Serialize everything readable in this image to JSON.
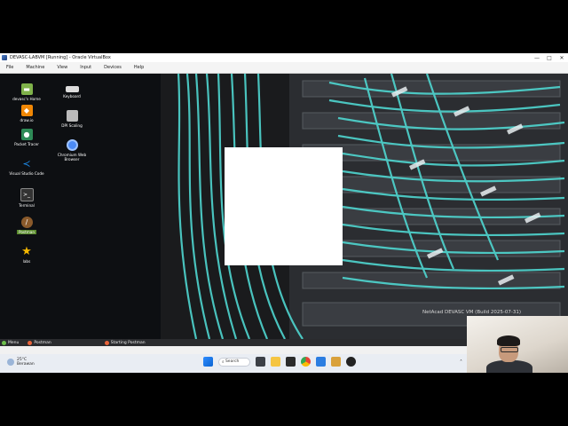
{
  "window": {
    "title": "DEVASC-LABVM [Running] - Oracle VirtualBox",
    "controls": [
      "—",
      "□",
      "✕"
    ]
  },
  "menu": [
    "File",
    "Machine",
    "View",
    "Input",
    "Devices",
    "Help"
  ],
  "desktop_icons": [
    {
      "label": "devasc's Home",
      "icon": "folder-icon",
      "color": "#7fb24a"
    },
    {
      "label": "draw.io",
      "icon": "drawio-icon",
      "color": "#f08705"
    },
    {
      "label": "Packet Tracer",
      "icon": "packet-tracer-icon",
      "color": "#2e8b57"
    },
    {
      "label": "Visual Studio Code",
      "icon": "vscode-icon",
      "color": "#1e88e5"
    },
    {
      "label": "Terminal",
      "icon": "terminal-icon",
      "color": "#333333"
    },
    {
      "label": "Postman",
      "icon": "postman-icon",
      "color": "#8a5a2b"
    },
    {
      "label": "labs",
      "icon": "star-icon",
      "color": "#f5b800"
    },
    {
      "label": "Keyboard",
      "icon": "keyboard-icon",
      "color": "#dddddd"
    },
    {
      "label": "DPI Scaling",
      "icon": "dpi-scaling-icon",
      "color": "#bbbbbb"
    },
    {
      "label": "Chromium Web Browser",
      "icon": "chromium-icon",
      "color": "#4c8bf5"
    }
  ],
  "wallpaper_watermark": "NetAcad DEVASC VM (Build 2025-07-31)",
  "guest_taskbar": [
    {
      "label": "Menu",
      "color": "#6dbf4b"
    },
    {
      "label": "Postman",
      "color": "#e8633a"
    },
    {
      "label": "Starting Postman",
      "color": "#e8633a"
    }
  ],
  "host_taskbar": {
    "weather_temp": "25°C",
    "weather_desc": "Berawan",
    "search_label": "Search"
  },
  "colors": {
    "cable": "#4fd6d0",
    "accent": "#0a64d2"
  }
}
